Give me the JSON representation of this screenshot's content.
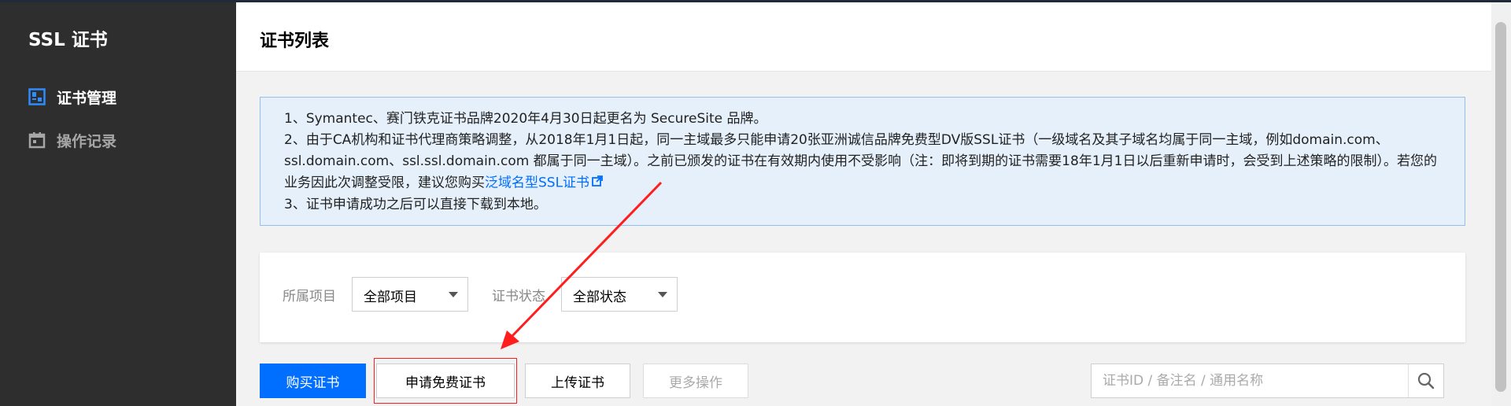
{
  "sidebar": {
    "title": "SSL 证书",
    "items": [
      {
        "label": "证书管理",
        "icon": "certificate-icon",
        "active": true
      },
      {
        "label": "操作记录",
        "icon": "calendar-icon",
        "active": false
      }
    ]
  },
  "main": {
    "title": "证书列表",
    "notice": {
      "line1": "1、Symantec、赛门铁克证书品牌2020年4月30日起更名为 SecureSite 品牌。",
      "line2_prefix": "2、由于CA机构和证书代理商策略调整，从2018年1月1日起，同一主域最多只能申请20张亚洲诚信品牌免费型DV版SSL证书（一级域名及其子域名均属于同一主域，例如domain.com、ssl.domain.com、ssl.ssl.domain.com 都属于同一主域）。之前已颁发的证书在有效期内使用不受影响（注：即将到期的证书需要18年1月1日以后重新申请时，会受到上述策略的限制）。若您的业务因此次调整受限，建议您购买",
      "line2_link": "泛域名型SSL证书",
      "line3": "3、证书申请成功之后可以直接下载到本地。"
    },
    "filters": {
      "project_label": "所属项目",
      "project_value": "全部项目",
      "status_label": "证书状态",
      "status_value": "全部状态"
    },
    "toolbar": {
      "buy": "购买证书",
      "apply_free": "申请免费证书",
      "upload": "上传证书",
      "more": "更多操作"
    },
    "search": {
      "placeholder": "证书ID / 备注名 / 通用名称"
    }
  },
  "colors": {
    "primary": "#006eff",
    "sidebar_bg": "#2e2e2e",
    "notice_bg": "#e5f0fb",
    "annotation_red": "#ff1e1e"
  }
}
